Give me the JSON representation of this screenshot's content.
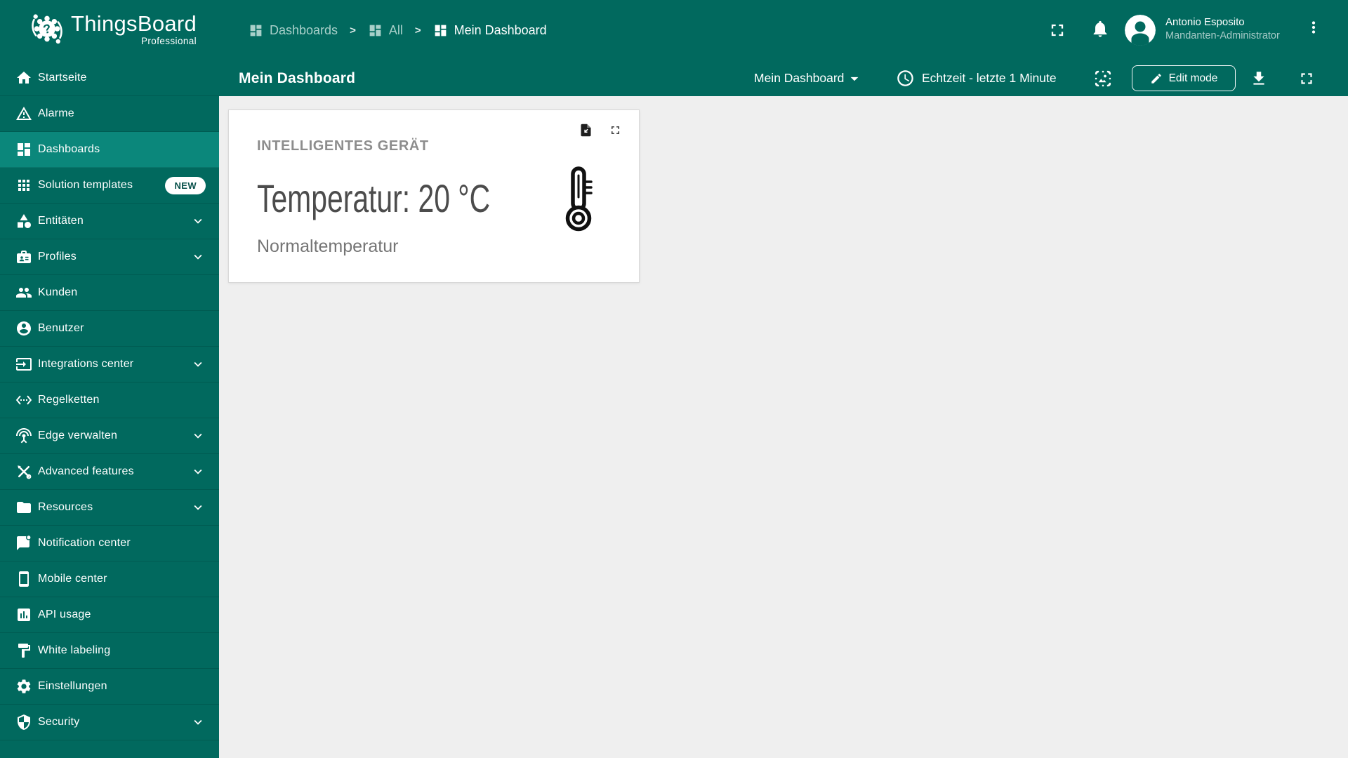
{
  "brand": {
    "name": "ThingsBoard",
    "edition": "Professional"
  },
  "header": {
    "breadcrumbs": [
      {
        "label": "Dashboards"
      },
      {
        "label": "All"
      },
      {
        "label": "Mein Dashboard"
      }
    ],
    "separator": ">",
    "user": {
      "name": "Antonio Esposito",
      "role": "Mandanten-Administrator"
    }
  },
  "toolbar": {
    "page_title": "Mein Dashboard",
    "state_select": "Mein Dashboard",
    "timewindow": "Echtzeit - letzte 1 Minute",
    "edit_button": "Edit mode"
  },
  "sidebar": {
    "items": [
      {
        "label": "Startseite",
        "icon": "home"
      },
      {
        "label": "Alarme",
        "icon": "warning"
      },
      {
        "label": "Dashboards",
        "icon": "dashboard",
        "active": true
      },
      {
        "label": "Solution templates",
        "icon": "apps",
        "badge": "NEW"
      },
      {
        "label": "Entitäten",
        "icon": "category",
        "expandable": true
      },
      {
        "label": "Profiles",
        "icon": "badge",
        "expandable": true
      },
      {
        "label": "Kunden",
        "icon": "people"
      },
      {
        "label": "Benutzer",
        "icon": "account"
      },
      {
        "label": "Integrations center",
        "icon": "input",
        "expandable": true
      },
      {
        "label": "Regelketten",
        "icon": "ethernet"
      },
      {
        "label": "Edge verwalten",
        "icon": "antenna",
        "expandable": true
      },
      {
        "label": "Advanced features",
        "icon": "construction",
        "expandable": true
      },
      {
        "label": "Resources",
        "icon": "folder",
        "expandable": true
      },
      {
        "label": "Notification center",
        "icon": "notification"
      },
      {
        "label": "Mobile center",
        "icon": "smartphone"
      },
      {
        "label": "API usage",
        "icon": "chart"
      },
      {
        "label": "White labeling",
        "icon": "paint"
      },
      {
        "label": "Einstellungen",
        "icon": "settings"
      },
      {
        "label": "Security",
        "icon": "shield",
        "expandable": true
      }
    ]
  },
  "widget": {
    "title": "INTELLIGENTES GERÄT",
    "value": "Temperatur: 20 °C",
    "subtitle": "Normaltemperatur"
  },
  "colors": {
    "primary": "#01695e",
    "active_item": "#0b877b",
    "content_bg": "#efefef",
    "badge_text": "#07504a"
  }
}
